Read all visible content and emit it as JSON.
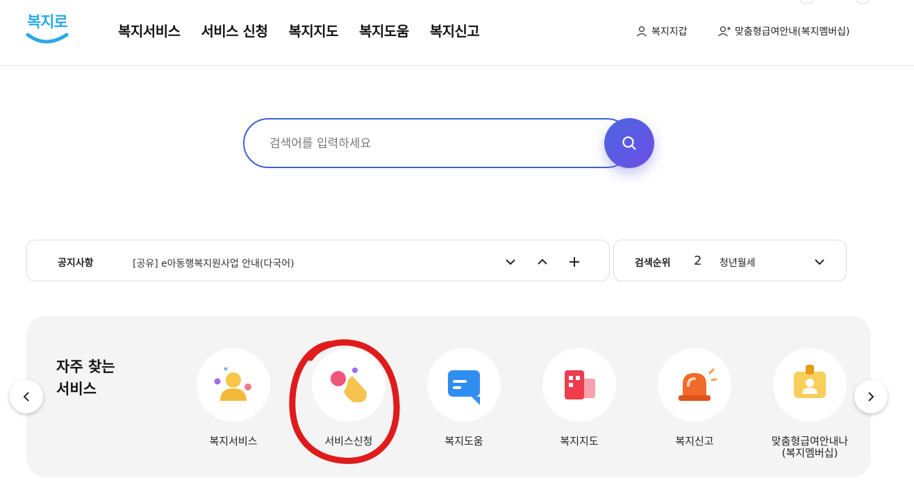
{
  "logo": {
    "text": "복지로"
  },
  "nav": {
    "items": [
      "복지서비스",
      "서비스 신청",
      "복지지도",
      "복지도움",
      "복지신고"
    ]
  },
  "utility": {
    "wallet": "복지지갑",
    "membership": "맞춤형급여안내(복지멤버십)"
  },
  "search": {
    "placeholder": "검색어를 입력하세요",
    "value": ""
  },
  "notice": {
    "title": "공지사항",
    "text": "[공유] e아동행복지원사업 안내(다국어)"
  },
  "ranking": {
    "title": "검색순위",
    "number": "2",
    "keyword": "청년월세"
  },
  "frequent": {
    "title_line1": "자주 찾는",
    "title_line2": "서비스",
    "items": [
      {
        "label": "복지서비스",
        "icon": "person-icon"
      },
      {
        "label": "서비스신청",
        "icon": "hand-tap-icon"
      },
      {
        "label": "복지도움",
        "icon": "chat-bubble-icon"
      },
      {
        "label": "복지지도",
        "icon": "building-map-icon"
      },
      {
        "label": "복지신고",
        "icon": "siren-icon"
      },
      {
        "label_line1": "맞춤형급여안내나",
        "label_line2": "(복지멤버십)",
        "icon": "id-badge-icon"
      }
    ]
  },
  "colors": {
    "accent": "#3f5fd0",
    "search_button": "#5b5ae0",
    "panel_bg": "#f4f4f4",
    "annotation": "#e01b1b"
  }
}
